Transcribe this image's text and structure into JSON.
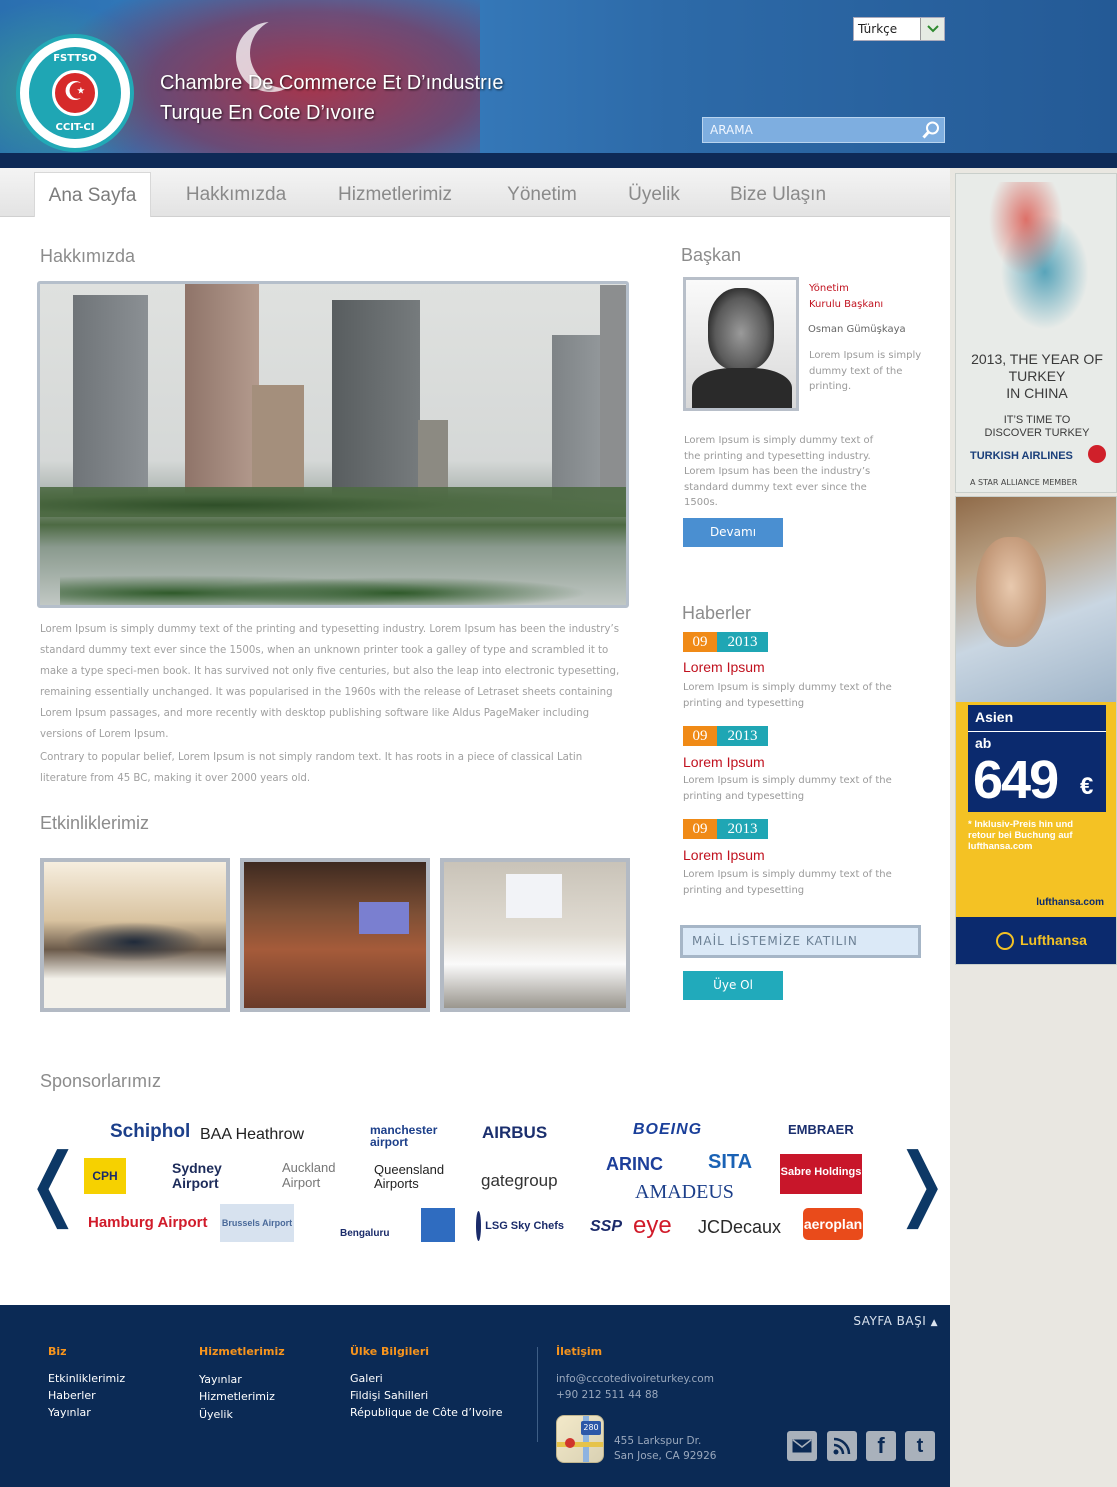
{
  "header": {
    "logo_top": "FSTTSO",
    "logo_bottom": "CCIT-CI",
    "title_line1": "Chambre De Commerce  Et D’ındustrıe",
    "title_line2": "Turque En Cote D’ıvoıre",
    "language": "Türkçe",
    "search_placeholder": "ARAMA"
  },
  "nav": [
    "Ana Sayfa",
    "Hakkımızda",
    "Hizmetlerimiz",
    "Yönetim",
    "Üyelik",
    "Bize Ulaşın"
  ],
  "about": {
    "title": "Hakkımızda",
    "para1": "Lorem Ipsum is simply dummy text of the printing and typesetting industry. Lorem Ipsum has been the industry’s standard dummy text ever since the 1500s, when an unknown printer took a galley of type and scrambled it to make a type speci-men book. It has survived not only five centuries, but also the leap into electronic typesetting, remaining essentially unchanged. It was popularised in the 1960s with the release of Letraset sheets containing Lorem Ipsum passages, and more recently with desktop publishing software like Aldus PageMaker including versions of Lorem Ipsum.",
    "para2": "Contrary to popular belief, Lorem Ipsum is not simply random text. It has roots in a piece of classical Latin literature from 45 BC, making it over 2000 years old."
  },
  "events": {
    "title": "Etkinliklerimiz"
  },
  "president": {
    "title": "Başkan",
    "role_line1": "Yönetim",
    "role_line2": "Kurulu Başkanı",
    "name": "Osman Gümüşkaya",
    "short": "Lorem Ipsum is simply dummy text of the printing.",
    "long": "Lorem Ipsum is simply dummy text of the printing and typesetting industry. Lorem Ipsum has been the industry’s standard dummy text ever since the 1500s.",
    "button": "Devamı"
  },
  "news": {
    "title": "Haberler",
    "items": [
      {
        "day": "09",
        "year": "2013",
        "headline": "Lorem Ipsum",
        "text": "Lorem Ipsum is simply dummy text of the printing and typesetting"
      },
      {
        "day": "09",
        "year": "2013",
        "headline": "Lorem Ipsum",
        "text": "Lorem Ipsum is simply dummy text of the printing and typesetting"
      },
      {
        "day": "09",
        "year": "2013",
        "headline": "Lorem Ipsum",
        "text": "Lorem Ipsum is simply dummy text of the printing and typesetting"
      }
    ]
  },
  "mailing": {
    "placeholder": "MAİL LİSTEMİZE KATILIN",
    "button": "Üye Ol"
  },
  "sponsors": {
    "title": "Sponsorlarımız",
    "logos": [
      "Schiphol",
      "BAA Heathrow",
      "manchester airport",
      "AIRBUS",
      "BOEING",
      "EMBRAER",
      "CPH",
      "Sydney Airport",
      "Auckland Airport",
      "Queensland Airports",
      "gategroup",
      "ARINC",
      "SITA",
      "Sabre Holdings",
      "AMADEUS",
      "Hamburg Airport",
      "Brussels Airport",
      "Bengaluru",
      "LSG Sky Chefs",
      "SSP",
      "eye",
      "JCDecaux",
      "aeroplan"
    ]
  },
  "footer": {
    "back_to_top": "SAYFA BAŞI",
    "columns": [
      {
        "title": "Biz",
        "links": [
          "Etkinliklerimiz",
          "Haberler",
          "Yayınlar"
        ]
      },
      {
        "title": "Hizmetlerimiz",
        "links": [
          "Yayınlar",
          "Hizmetlerimiz",
          "Üyelik"
        ]
      },
      {
        "title": "Ülke Bilgileri",
        "links": [
          "Galeri",
          "Fildişi Sahilleri",
          "République de Côte d’Ivoire"
        ]
      }
    ],
    "contact_title": "İletişim",
    "email": "info@cccotedivoireturkey.com",
    "phone": "+90 212 511 44 88",
    "address1": "455 Larkspur Dr.",
    "address2": "San Jose, CA 92926",
    "map_badge": "280"
  },
  "ads": {
    "ad1_line1": "2013, THE YEAR OF",
    "ad1_line2": "TURKEY",
    "ad1_line3": "IN CHINA",
    "ad1_line4": "IT’S TIME TO",
    "ad1_line5": "DISCOVER TURKEY",
    "ad1_brand": "TURKISH AIRLINES",
    "ad1_member": "A STAR ALLIANCE MEMBER",
    "ad2_dest": "Asien",
    "ad2_ab": "ab",
    "ad2_price": "649",
    "ad2_currency": "€",
    "ad2_note": "* Inklusiv-Preis hin und retour bei Buchung auf lufthansa.com",
    "ad2_url": "lufthansa.com",
    "ad2_brand": "Lufthansa"
  },
  "colors": {
    "header_blue": "#2a6fb0",
    "navy": "#0b2a55",
    "teal": "#1fa6b4",
    "orange": "#f08a16",
    "red": "#c1121f"
  }
}
